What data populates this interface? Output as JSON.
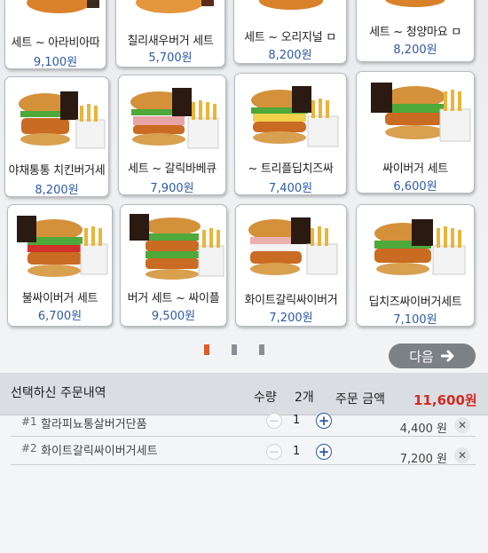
{
  "menu": {
    "items": [
      {
        "name": "세트 ~ 아라비아따",
        "price": "9,100원",
        "image": "chicken-burger-set"
      },
      {
        "name": "칠리새우버거 세트",
        "price": "5,700원",
        "image": "shrimp-burger-set"
      },
      {
        "name": "세트 ~ 오리지널 ㅁ",
        "price": "8,200원",
        "image": "chicken-burger-set"
      },
      {
        "name": "세트 ~ 청양마요 ㅁ",
        "price": "8,200원",
        "image": "chicken-burger-set"
      },
      {
        "name": "야채통통 치킨버거세",
        "price": "8,200원",
        "image": "chicken-burger-set"
      },
      {
        "name": "세트 ~ 갈릭바베큐",
        "price": "7,900원",
        "image": "chicken-burger-set"
      },
      {
        "name": "~ 트리플딥치즈싸",
        "price": "7,400원",
        "image": "chicken-burger-set"
      },
      {
        "name": "싸이버거 세트",
        "price": "6,600원",
        "image": "chicken-burger-set"
      },
      {
        "name": "불싸이버거 세트",
        "price": "6,700원",
        "image": "chicken-burger-set"
      },
      {
        "name": "버거 세트 ~ 싸이플",
        "price": "9,500원",
        "image": "chicken-burger-set"
      },
      {
        "name": "화이트갈릭싸이버거",
        "price": "7,200원",
        "image": "chicken-burger-set"
      },
      {
        "name": "딥치즈싸이버거세트",
        "price": "7,100원",
        "image": "chicken-burger-set"
      }
    ]
  },
  "pagination": {
    "pages": 3,
    "current": 1
  },
  "next_button": {
    "label": "다음",
    "icon": "arrow-right-icon"
  },
  "order": {
    "title": "선택하신 주문내역",
    "qty_label": "수량",
    "qty_value": "2개",
    "amount_label": "주문 금액",
    "amount_value": "11,600원",
    "rows": [
      {
        "idx": "#1",
        "name": "할라피뇨통살버거단품",
        "qty": "1",
        "price": "4,400 원"
      },
      {
        "idx": "#2",
        "name": "화이트갈릭싸이버거세트",
        "qty": "1",
        "price": "7,200 원"
      }
    ]
  },
  "colors": {
    "accent": "#d12b22",
    "price": "#2e5aa8",
    "button": "#7c8186",
    "page_active": "#e05a2a",
    "page_inactive": "#8b9096"
  }
}
